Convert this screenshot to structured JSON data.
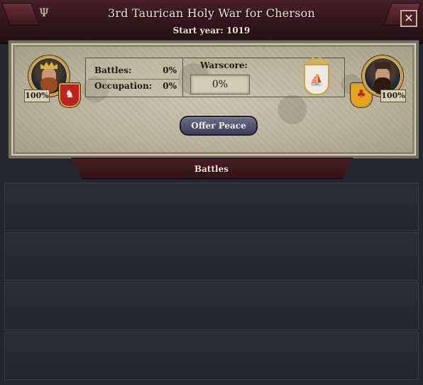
{
  "window": {
    "title": "3rd Taurican Holy War for Cherson",
    "subtitle": "Start year: 1019",
    "close_icon": "close-icon",
    "menorah_icon": "menorah-icon"
  },
  "attacker": {
    "percent": "100%",
    "portrait_icon": "portrait-icon",
    "coat_icon": "red-dragon-shield-icon"
  },
  "defender": {
    "percent": "100%",
    "portrait_icon": "portrait-icon",
    "coat_icon": "gold-red-trees-shield-icon"
  },
  "stats": {
    "battles_label": "Battles:",
    "battles_value": "0%",
    "occupation_label": "Occupation:",
    "occupation_value": "0%"
  },
  "warscore": {
    "label": "Warscore:",
    "value": "0%"
  },
  "target": {
    "coat_icon": "ship-shield-icon"
  },
  "actions": {
    "offer_peace": "Offer Peace"
  },
  "battles": {
    "header": "Battles",
    "rows": []
  },
  "colors": {
    "title_banner": "#3a1a20",
    "offer_button": "#4e4e6c",
    "parchment": "#bfb8a2"
  }
}
